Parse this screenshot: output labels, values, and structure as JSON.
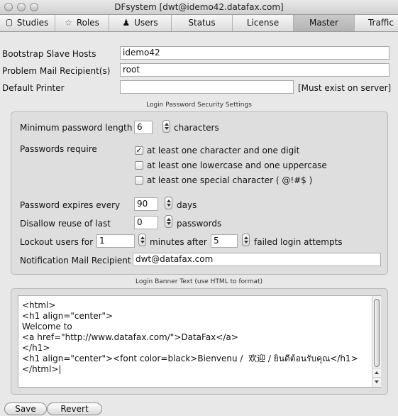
{
  "window": {
    "title": "DFsystem [dwt@idemo42.datafax.com]"
  },
  "tabs": [
    {
      "label": "Studies",
      "icon": "database-icon"
    },
    {
      "label": "Roles",
      "icon": "person-icon"
    },
    {
      "label": "Users",
      "icon": "users-icon"
    },
    {
      "label": "Status"
    },
    {
      "label": "License"
    },
    {
      "label": "Master",
      "selected": true
    },
    {
      "label": "Traffic"
    }
  ],
  "general": {
    "bootstrap_label": "Bootstrap Slave Hosts",
    "bootstrap_value": "idemo42",
    "problem_mail_label": "Problem Mail Recipient(s)",
    "problem_mail_value": "root",
    "printer_label": "Default Printer",
    "printer_value": "",
    "printer_note": "[Must exist on server]"
  },
  "security": {
    "group_title": "Login Password Security Settings",
    "min_length_label": "Minimum password length",
    "min_length_value": "6",
    "min_length_unit": "characters",
    "require_label": "Passwords require",
    "require_options": [
      {
        "label": "at least one character and one digit",
        "checked": true
      },
      {
        "label": "at least one lowercase and one uppercase",
        "checked": false
      },
      {
        "label": "at least one special character ( @!#$ )",
        "checked": false
      }
    ],
    "expires_label": "Password expires every",
    "expires_value": "90",
    "expires_unit": "days",
    "reuse_label": "Disallow reuse of last",
    "reuse_value": "0",
    "reuse_unit": "passwords",
    "lockout_label": "Lockout users for",
    "lockout_value": "1",
    "lockout_middle": "minutes after",
    "failed_value": "5",
    "failed_unit": "failed login attempts",
    "notify_label": "Notification Mail Recipient",
    "notify_value": "dwt@datafax.com"
  },
  "banner": {
    "group_title": "Login Banner Text (use HTML to format)",
    "text": "<html>\n<h1 align=\"center\">\nWelcome to\n<a href=\"http://www.datafax.com/\">DataFax</a>\n</h1>\n<h1 align=\"center\"><font color=black>Bienvenu /  欢迎 / ยินดีต้อนรับคุณ</h1>\n</html>|"
  },
  "buttons": {
    "save": "Save",
    "revert": "Revert"
  }
}
